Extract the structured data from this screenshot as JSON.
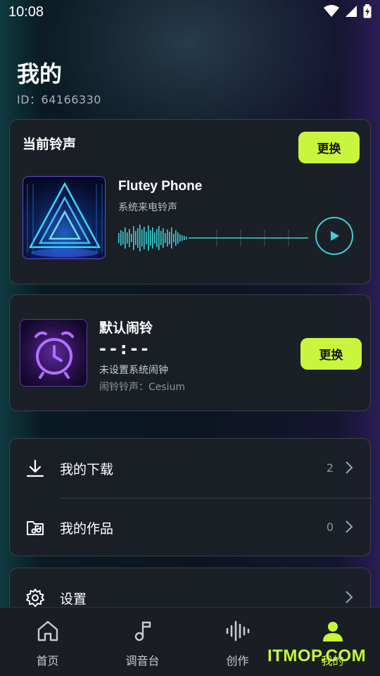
{
  "status_bar": {
    "time": "10:08"
  },
  "header": {
    "title": "我的",
    "user_id": "ID：64166330"
  },
  "ringtone_card": {
    "section_label": "当前铃声",
    "swap_label": "更换",
    "song_title": "Flutey Phone",
    "song_subtitle": "系统来电铃声"
  },
  "alarm_card": {
    "title": "默认闹铃",
    "time_display": "--:--",
    "status": "未设置系统闹钟",
    "tone": "闹铃铃声：Cesium",
    "swap_label": "更换"
  },
  "menu": {
    "items": [
      {
        "label": "我的下载",
        "count": "2",
        "icon": "download-icon"
      },
      {
        "label": "我的作品",
        "count": "0",
        "icon": "music-folder-icon"
      }
    ],
    "settings": {
      "label": "设置",
      "icon": "gear-icon"
    }
  },
  "bottom_nav": {
    "items": [
      {
        "label": "首页",
        "icon": "home-icon",
        "active": false
      },
      {
        "label": "调音台",
        "icon": "music-note-icon",
        "active": false
      },
      {
        "label": "创作",
        "icon": "waveform-icon",
        "active": false
      },
      {
        "label": "我的",
        "icon": "person-icon",
        "active": true
      }
    ]
  },
  "watermark": "ITMOP.COM",
  "colors": {
    "accent": "#c9f53c",
    "play_ring": "#3fd0d6",
    "card_bg": "#1c2026"
  }
}
